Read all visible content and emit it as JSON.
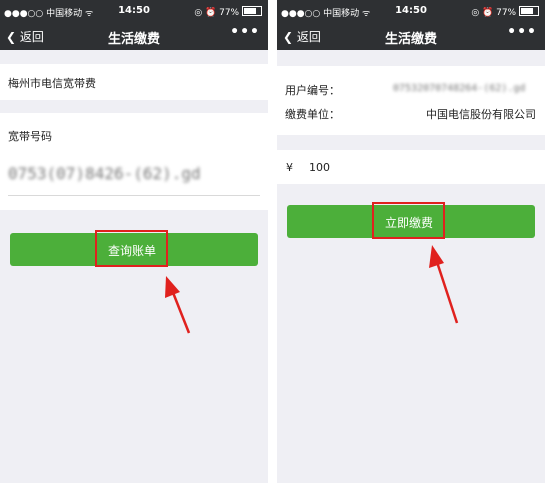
{
  "status": {
    "carrier": "●●●○○ 中国移动 ᯤ",
    "time": "14:50",
    "battery": "◎ ⏰ 77%"
  },
  "nav": {
    "back_label": "返回",
    "title": "生活缴费",
    "more_label": "•••"
  },
  "left": {
    "biller_name": "梅州市电信宽带费",
    "account_label": "宽带号码",
    "account_value_blurred": "0753(07)8426-(62).gd",
    "query_button_label": "查询账单"
  },
  "right": {
    "user_id_label": "用户编号：",
    "user_id_blurred": "07532070748264-(62).gd",
    "company_label": "缴费单位：",
    "company_value": "中国电信股份有限公司",
    "currency_symbol": "¥",
    "amount": "100",
    "pay_button_label": "立即缴费"
  },
  "colors": {
    "nav_bg": "#2e3033",
    "button_green": "#4caf3a",
    "highlight_red": "#e0211e",
    "page_bg": "#efeff4"
  }
}
